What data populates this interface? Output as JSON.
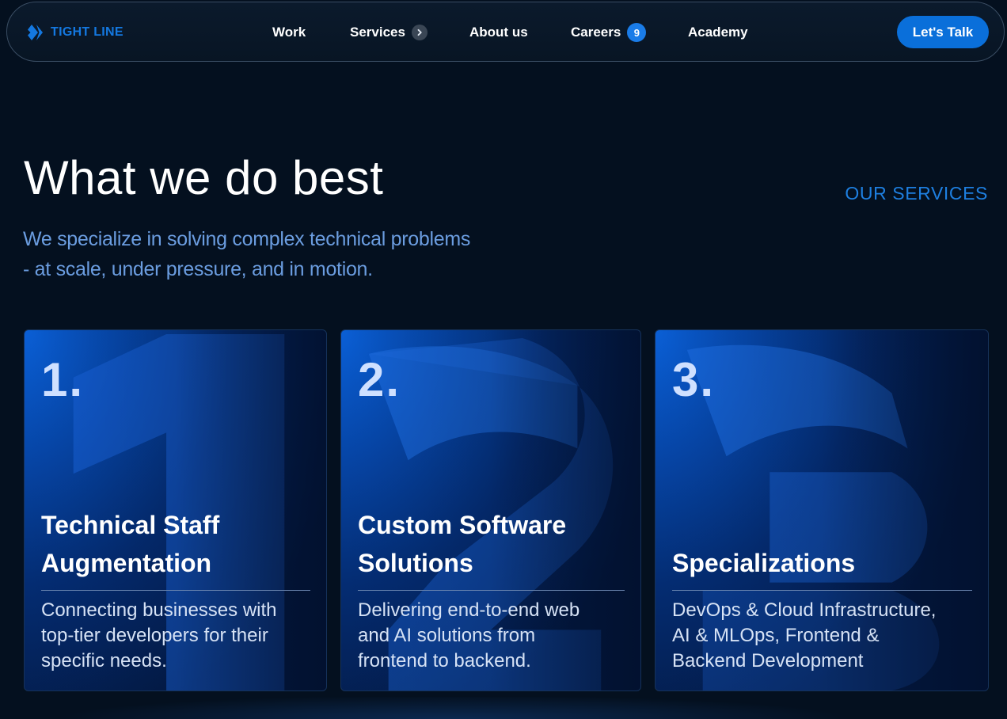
{
  "brand": {
    "name": "TIGHT LINE",
    "logo_icon": "double-chevron-diamond-icon",
    "accent": "#1478e0"
  },
  "nav": {
    "items": [
      {
        "label": "Work"
      },
      {
        "label": "Services",
        "icon": "chevron-right-icon"
      },
      {
        "label": "About us"
      },
      {
        "label": "Careers",
        "badge": "9"
      },
      {
        "label": "Academy"
      }
    ],
    "cta_label": "Let's Talk"
  },
  "hero": {
    "title": "What we do best",
    "eyebrow": "OUR SERVICES",
    "subtitle_lines": [
      "We specialize in solving complex technical problems",
      "- at scale, under pressure, and in motion."
    ]
  },
  "cards": [
    {
      "number": "1.",
      "title_lines": [
        "Technical Staff",
        "Augmentation"
      ],
      "desc_lines": [
        "Connecting businesses with",
        "top-tier developers for their",
        "specific needs."
      ]
    },
    {
      "number": "2.",
      "title_lines": [
        "Custom Software",
        "Solutions"
      ],
      "desc_lines": [
        "Delivering end-to-end web",
        "and AI solutions from",
        "frontend to backend."
      ]
    },
    {
      "number": "3.",
      "title_lines": [
        "Specializations"
      ],
      "desc_lines": [
        "DevOps & Cloud Infrastructure,",
        "AI & MLOps, Frontend &",
        "Backend Development"
      ]
    }
  ],
  "colors": {
    "background": "#04101f",
    "cta": "#0a6fda",
    "eyebrow": "#1e7fe0",
    "subtitle": "#6b9de0"
  }
}
